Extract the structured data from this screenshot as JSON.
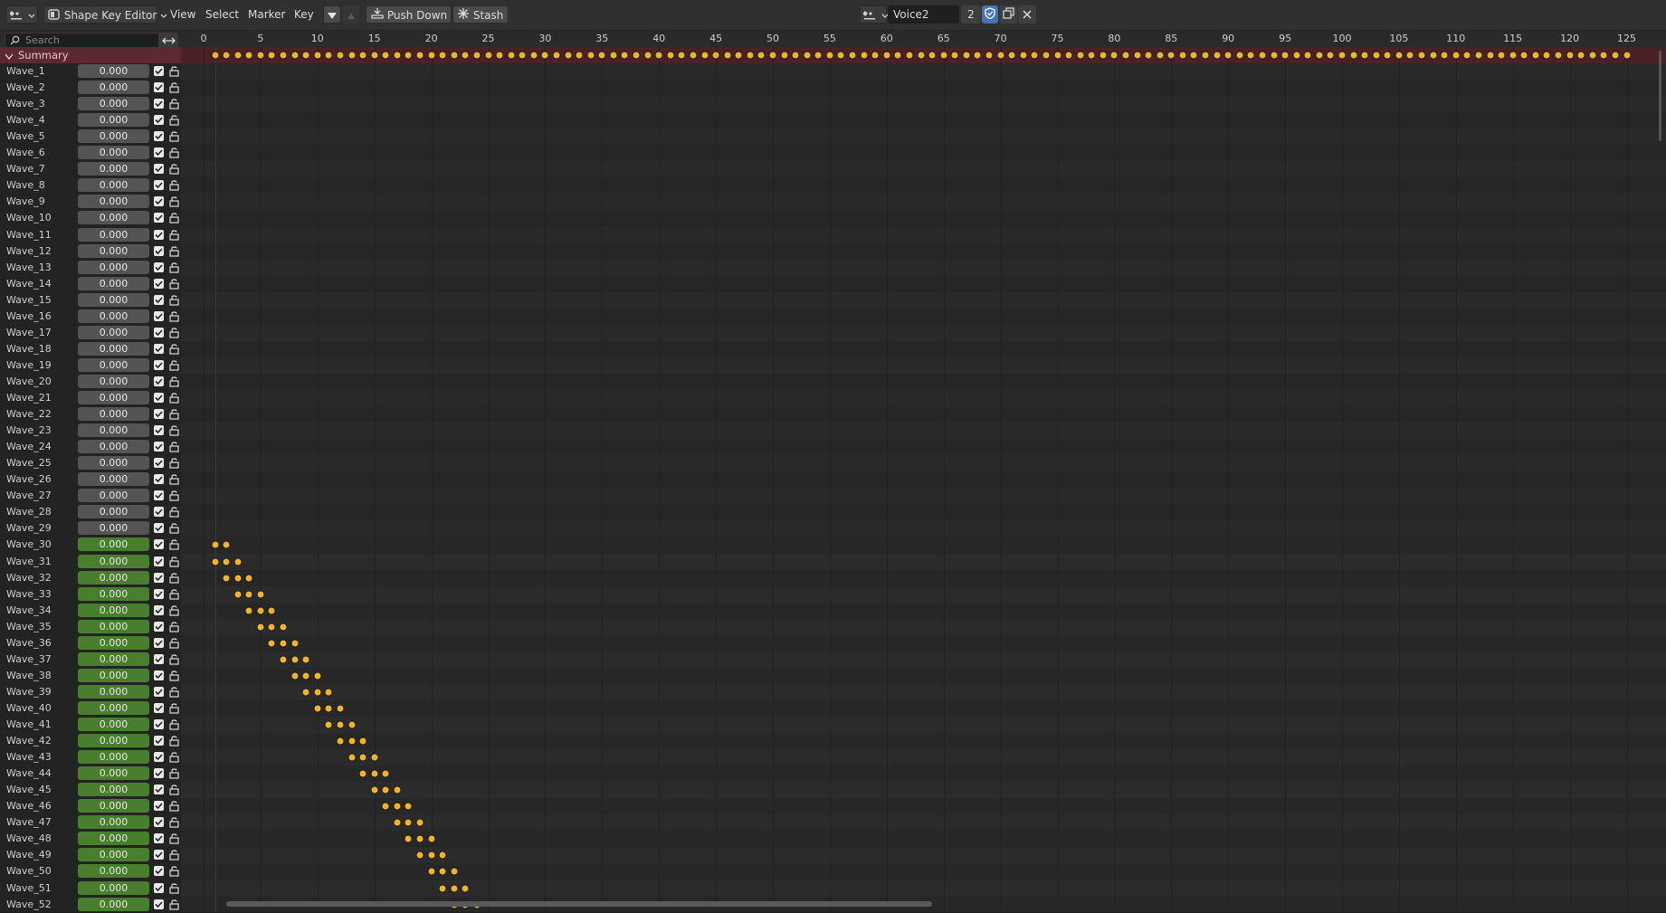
{
  "header": {
    "editor_type": "Shape Key Editor",
    "menus": [
      "View",
      "Select",
      "Marker",
      "Key"
    ],
    "push_down_label": "Push Down",
    "stash_label": "Stash",
    "action_name": "Voice2",
    "users_count": "2"
  },
  "search": {
    "placeholder": "Search"
  },
  "summary": {
    "label": "Summary"
  },
  "ruler": {
    "ticks": [
      "0",
      "5",
      "10",
      "15",
      "20",
      "25",
      "30",
      "35",
      "40",
      "45",
      "50",
      "55",
      "60",
      "65",
      "70",
      "75",
      "80",
      "85",
      "90",
      "95",
      "100",
      "105",
      "110",
      "115",
      "120",
      "125"
    ]
  },
  "channels": [
    {
      "name": "Wave_1",
      "value": "0.000"
    },
    {
      "name": "Wave_2",
      "value": "0.000"
    },
    {
      "name": "Wave_3",
      "value": "0.000"
    },
    {
      "name": "Wave_4",
      "value": "0.000"
    },
    {
      "name": "Wave_5",
      "value": "0.000"
    },
    {
      "name": "Wave_6",
      "value": "0.000"
    },
    {
      "name": "Wave_7",
      "value": "0.000"
    },
    {
      "name": "Wave_8",
      "value": "0.000"
    },
    {
      "name": "Wave_9",
      "value": "0.000"
    },
    {
      "name": "Wave_10",
      "value": "0.000"
    },
    {
      "name": "Wave_11",
      "value": "0.000"
    },
    {
      "name": "Wave_12",
      "value": "0.000"
    },
    {
      "name": "Wave_13",
      "value": "0.000"
    },
    {
      "name": "Wave_14",
      "value": "0.000"
    },
    {
      "name": "Wave_15",
      "value": "0.000"
    },
    {
      "name": "Wave_16",
      "value": "0.000"
    },
    {
      "name": "Wave_17",
      "value": "0.000"
    },
    {
      "name": "Wave_18",
      "value": "0.000"
    },
    {
      "name": "Wave_19",
      "value": "0.000"
    },
    {
      "name": "Wave_20",
      "value": "0.000"
    },
    {
      "name": "Wave_21",
      "value": "0.000"
    },
    {
      "name": "Wave_22",
      "value": "0.000"
    },
    {
      "name": "Wave_23",
      "value": "0.000"
    },
    {
      "name": "Wave_24",
      "value": "0.000"
    },
    {
      "name": "Wave_25",
      "value": "0.000"
    },
    {
      "name": "Wave_26",
      "value": "0.000"
    },
    {
      "name": "Wave_27",
      "value": "0.000"
    },
    {
      "name": "Wave_28",
      "value": "0.000"
    },
    {
      "name": "Wave_29",
      "value": "0.000"
    },
    {
      "name": "Wave_30",
      "value": "0.000",
      "animated": true,
      "keys": [
        1,
        2
      ]
    },
    {
      "name": "Wave_31",
      "value": "0.000",
      "animated": true,
      "keys": [
        1,
        2,
        3
      ]
    },
    {
      "name": "Wave_32",
      "value": "0.000",
      "animated": true,
      "keys": [
        2,
        3,
        4
      ]
    },
    {
      "name": "Wave_33",
      "value": "0.000",
      "animated": true,
      "keys": [
        3,
        4,
        5
      ]
    },
    {
      "name": "Wave_34",
      "value": "0.000",
      "animated": true,
      "keys": [
        4,
        5,
        6
      ]
    },
    {
      "name": "Wave_35",
      "value": "0.000",
      "animated": true,
      "keys": [
        5,
        6,
        7
      ]
    },
    {
      "name": "Wave_36",
      "value": "0.000",
      "animated": true,
      "keys": [
        6,
        7,
        8
      ]
    },
    {
      "name": "Wave_37",
      "value": "0.000",
      "animated": true,
      "keys": [
        7,
        8,
        9
      ]
    },
    {
      "name": "Wave_38",
      "value": "0.000",
      "animated": true,
      "keys": [
        8,
        9,
        10
      ]
    },
    {
      "name": "Wave_39",
      "value": "0.000",
      "animated": true,
      "keys": [
        9,
        10,
        11
      ]
    },
    {
      "name": "Wave_40",
      "value": "0.000",
      "animated": true,
      "keys": [
        10,
        11,
        12
      ]
    },
    {
      "name": "Wave_41",
      "value": "0.000",
      "animated": true,
      "keys": [
        11,
        12,
        13
      ]
    },
    {
      "name": "Wave_42",
      "value": "0.000",
      "animated": true,
      "keys": [
        12,
        13,
        14
      ]
    },
    {
      "name": "Wave_43",
      "value": "0.000",
      "animated": true,
      "keys": [
        13,
        14,
        15
      ]
    },
    {
      "name": "Wave_44",
      "value": "0.000",
      "animated": true,
      "keys": [
        14,
        15,
        16
      ]
    },
    {
      "name": "Wave_45",
      "value": "0.000",
      "animated": true,
      "keys": [
        15,
        16,
        17
      ]
    },
    {
      "name": "Wave_46",
      "value": "0.000",
      "animated": true,
      "keys": [
        16,
        17,
        18
      ]
    },
    {
      "name": "Wave_47",
      "value": "0.000",
      "animated": true,
      "keys": [
        17,
        18,
        19
      ]
    },
    {
      "name": "Wave_48",
      "value": "0.000",
      "animated": true,
      "keys": [
        18,
        19,
        20
      ]
    },
    {
      "name": "Wave_49",
      "value": "0.000",
      "animated": true,
      "keys": [
        19,
        20,
        21
      ]
    },
    {
      "name": "Wave_50",
      "value": "0.000",
      "animated": true,
      "keys": [
        20,
        21,
        22
      ]
    },
    {
      "name": "Wave_51",
      "value": "0.000",
      "animated": true,
      "keys": [
        21,
        22,
        23
      ]
    },
    {
      "name": "Wave_52",
      "value": "0.000",
      "animated": true,
      "keys": [
        22,
        23,
        24
      ]
    }
  ],
  "summary_keys": {
    "first": 1,
    "last": 125
  },
  "colors": {
    "accent": "#f0b429",
    "summary_bg": "#5b2a30",
    "animated_field": "#497e2e",
    "header_bg": "#303030"
  },
  "icons": [
    "editor-type-icon",
    "shape-key-editor-icon",
    "filter-icon",
    "push-down-icon",
    "stash-icon",
    "action-browse-icon",
    "fake-user-shield-icon",
    "duplicate-icon",
    "unlink-close-icon",
    "search-icon",
    "swap-icon",
    "checkbox-icon",
    "lock-icon",
    "chevron-down-icon"
  ]
}
